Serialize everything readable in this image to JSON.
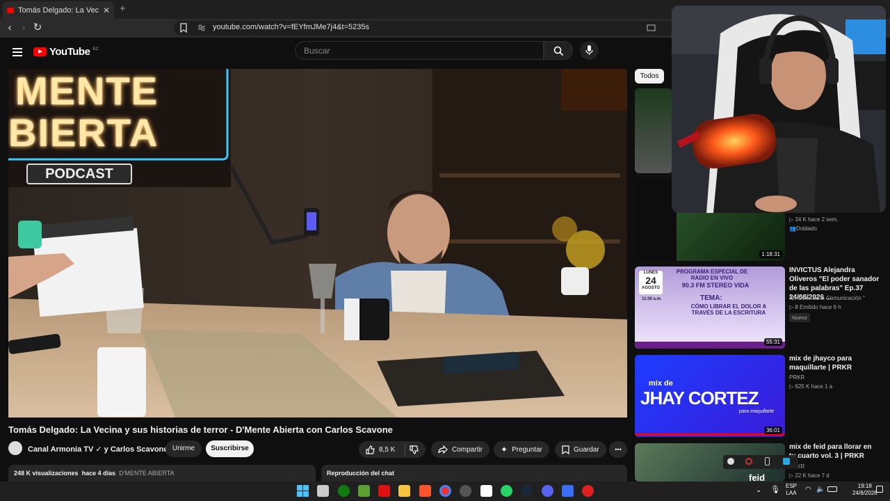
{
  "browser": {
    "tab_title": "Tomás Delgado: La Vecina y sus",
    "tab_close": "✕",
    "new_tab": "+",
    "url": "youtube.com/watch?v=fEYfmJMe7j4&t=5235s"
  },
  "youtube": {
    "logo_text": "YouTube",
    "country": "EC",
    "search_placeholder": "Buscar"
  },
  "video": {
    "sign_line1": "MENTE",
    "sign_line2": "BIERTA",
    "sign_podcast": "PODCAST",
    "title": "Tomás Delgado: La Vecina y sus historias de terror - D'Mente Abierta con Carlos Scavone",
    "channel": "Canal Armonía TV ✓ y Carlos Scavone",
    "join_label": "Unirme",
    "subscribe_label": "Suscribirse",
    "likes": "8,5 K",
    "share_label": "Compartir",
    "ask_label": "Preguntar",
    "save_label": "Guardar",
    "more": "•••",
    "views": "248 K visualizaciones",
    "age": "hace 4 días",
    "hashtag": "D'MENTE ABIERTA",
    "chat_label": "Reproducción del chat"
  },
  "sidebar": {
    "chip_all": "Todos",
    "items": [
      {
        "meta": "34 K  hace 2 sem.",
        "badge": "Doblado",
        "duration": "1:18:31"
      },
      {
        "title": "INVICTUS Alejandra Oliveros \"El poder sanador de las palabras\" Ep.37 24/08/2026 ...",
        "channel": "\"El Color de la Comunicación \"",
        "meta": "8  Emitido hace 6 h",
        "badge": "Nuevo",
        "duration": "55:31",
        "thumb_head": "PROGRAMA ESPECIAL DE RADIO EN VIVO",
        "thumb_freq": "90.3 FM STEREO VIDA",
        "thumb_tema": "TEMA:",
        "thumb_topic": "CÓMO LIBRAR EL DOLOR A TRAVÉS DE LA ESCRITURA",
        "thumb_day": "LUNES",
        "thumb_date": "24",
        "thumb_month": "AGOSTO",
        "thumb_time": "11:00 a.m."
      },
      {
        "title": "mix de jhayco para maquillarte | PRKR",
        "channel": "PRKR",
        "meta": "625 K  hace 1 a",
        "duration": "36:01",
        "thumb_text1": "mix de",
        "thumb_text2": "JHAY CORTEZ",
        "thumb_text3": "para maquillarte"
      },
      {
        "title": "mix de feid para llorar en tu cuarto vol. 3 | PRKR",
        "channel": "PRKR",
        "meta": "22 K  hace 7 d",
        "thumb_text": "feid"
      }
    ]
  },
  "taskbar": {
    "lang_top": "ESP",
    "lang_bottom": "LAA",
    "time": "19:18",
    "date": "24/8/2026"
  }
}
